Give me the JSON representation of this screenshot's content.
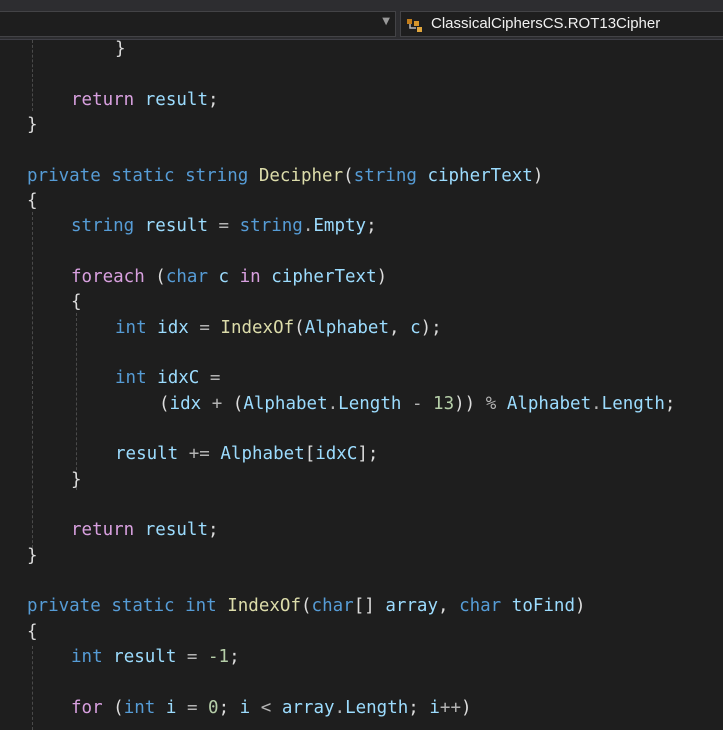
{
  "navigation_bar": {
    "left_dropdown_value": "",
    "right_dropdown_value": "ClassicalCiphersCS.ROT13Cipher",
    "member_icon": "class-member-icon",
    "dropdown_arrow_icon": "chevron-down-icon"
  },
  "colors": {
    "background": "#1e1e1e",
    "keyword": "#569cd6",
    "control_keyword": "#d8a0df",
    "method": "#dcdcaa",
    "identifier": "#9cdcfe",
    "number": "#b5cea8",
    "operator": "#b4b4b4",
    "plain": "#dcdcdc"
  },
  "editor": {
    "lines": [
      {
        "indent": 2,
        "tokens": [
          {
            "t": "}",
            "c": "pl"
          }
        ]
      },
      {
        "indent": 0,
        "tokens": []
      },
      {
        "indent": 1,
        "tokens": [
          {
            "t": "return",
            "c": "kw2"
          },
          {
            "t": " ",
            "c": "pl"
          },
          {
            "t": "result",
            "c": "var"
          },
          {
            "t": ";",
            "c": "pl"
          }
        ]
      },
      {
        "indent": 0,
        "tokens": [
          {
            "t": "}",
            "c": "pl"
          }
        ]
      },
      {
        "indent": 0,
        "tokens": []
      },
      {
        "indent": 0,
        "tokens": [
          {
            "t": "private",
            "c": "kw"
          },
          {
            "t": " ",
            "c": "pl"
          },
          {
            "t": "static",
            "c": "kw"
          },
          {
            "t": " ",
            "c": "pl"
          },
          {
            "t": "string",
            "c": "kw"
          },
          {
            "t": " ",
            "c": "pl"
          },
          {
            "t": "Decipher",
            "c": "fn"
          },
          {
            "t": "(",
            "c": "pl"
          },
          {
            "t": "string",
            "c": "kw"
          },
          {
            "t": " ",
            "c": "pl"
          },
          {
            "t": "cipherText",
            "c": "var"
          },
          {
            "t": ")",
            "c": "pl"
          }
        ]
      },
      {
        "indent": 0,
        "tokens": [
          {
            "t": "{",
            "c": "pl"
          }
        ]
      },
      {
        "indent": 1,
        "tokens": [
          {
            "t": "string",
            "c": "kw"
          },
          {
            "t": " ",
            "c": "pl"
          },
          {
            "t": "result",
            "c": "var"
          },
          {
            "t": " ",
            "c": "pl"
          },
          {
            "t": "=",
            "c": "op"
          },
          {
            "t": " ",
            "c": "pl"
          },
          {
            "t": "string",
            "c": "kw"
          },
          {
            "t": ".",
            "c": "op"
          },
          {
            "t": "Empty",
            "c": "var"
          },
          {
            "t": ";",
            "c": "pl"
          }
        ]
      },
      {
        "indent": 0,
        "tokens": []
      },
      {
        "indent": 1,
        "tokens": [
          {
            "t": "foreach",
            "c": "kw2"
          },
          {
            "t": " (",
            "c": "pl"
          },
          {
            "t": "char",
            "c": "kw"
          },
          {
            "t": " ",
            "c": "pl"
          },
          {
            "t": "c",
            "c": "var"
          },
          {
            "t": " ",
            "c": "pl"
          },
          {
            "t": "in",
            "c": "kw2"
          },
          {
            "t": " ",
            "c": "pl"
          },
          {
            "t": "cipherText",
            "c": "var"
          },
          {
            "t": ")",
            "c": "pl"
          }
        ]
      },
      {
        "indent": 1,
        "tokens": [
          {
            "t": "{",
            "c": "pl"
          }
        ]
      },
      {
        "indent": 2,
        "tokens": [
          {
            "t": "int",
            "c": "kw"
          },
          {
            "t": " ",
            "c": "pl"
          },
          {
            "t": "idx",
            "c": "var"
          },
          {
            "t": " ",
            "c": "pl"
          },
          {
            "t": "=",
            "c": "op"
          },
          {
            "t": " ",
            "c": "pl"
          },
          {
            "t": "IndexOf",
            "c": "fn"
          },
          {
            "t": "(",
            "c": "pl"
          },
          {
            "t": "Alphabet",
            "c": "var"
          },
          {
            "t": ", ",
            "c": "pl"
          },
          {
            "t": "c",
            "c": "var"
          },
          {
            "t": ");",
            "c": "pl"
          }
        ]
      },
      {
        "indent": 0,
        "tokens": []
      },
      {
        "indent": 2,
        "tokens": [
          {
            "t": "int",
            "c": "kw"
          },
          {
            "t": " ",
            "c": "pl"
          },
          {
            "t": "idxC",
            "c": "var"
          },
          {
            "t": " ",
            "c": "pl"
          },
          {
            "t": "=",
            "c": "op"
          }
        ]
      },
      {
        "indent": 3,
        "tokens": [
          {
            "t": "(",
            "c": "pl"
          },
          {
            "t": "idx",
            "c": "var"
          },
          {
            "t": " ",
            "c": "pl"
          },
          {
            "t": "+",
            "c": "op"
          },
          {
            "t": " (",
            "c": "pl"
          },
          {
            "t": "Alphabet",
            "c": "var"
          },
          {
            "t": ".",
            "c": "op"
          },
          {
            "t": "Length",
            "c": "var"
          },
          {
            "t": " ",
            "c": "pl"
          },
          {
            "t": "-",
            "c": "op"
          },
          {
            "t": " ",
            "c": "pl"
          },
          {
            "t": "13",
            "c": "num"
          },
          {
            "t": ")) ",
            "c": "pl"
          },
          {
            "t": "%",
            "c": "op"
          },
          {
            "t": " ",
            "c": "pl"
          },
          {
            "t": "Alphabet",
            "c": "var"
          },
          {
            "t": ".",
            "c": "op"
          },
          {
            "t": "Length",
            "c": "var"
          },
          {
            "t": ";",
            "c": "pl"
          }
        ]
      },
      {
        "indent": 0,
        "tokens": []
      },
      {
        "indent": 2,
        "tokens": [
          {
            "t": "result",
            "c": "var"
          },
          {
            "t": " ",
            "c": "pl"
          },
          {
            "t": "+=",
            "c": "op"
          },
          {
            "t": " ",
            "c": "pl"
          },
          {
            "t": "Alphabet",
            "c": "var"
          },
          {
            "t": "[",
            "c": "pl"
          },
          {
            "t": "idxC",
            "c": "var"
          },
          {
            "t": "];",
            "c": "pl"
          }
        ]
      },
      {
        "indent": 1,
        "tokens": [
          {
            "t": "}",
            "c": "pl"
          }
        ]
      },
      {
        "indent": 0,
        "tokens": []
      },
      {
        "indent": 1,
        "tokens": [
          {
            "t": "return",
            "c": "kw2"
          },
          {
            "t": " ",
            "c": "pl"
          },
          {
            "t": "result",
            "c": "var"
          },
          {
            "t": ";",
            "c": "pl"
          }
        ]
      },
      {
        "indent": 0,
        "tokens": [
          {
            "t": "}",
            "c": "pl"
          }
        ]
      },
      {
        "indent": 0,
        "tokens": []
      },
      {
        "indent": 0,
        "tokens": [
          {
            "t": "private",
            "c": "kw"
          },
          {
            "t": " ",
            "c": "pl"
          },
          {
            "t": "static",
            "c": "kw"
          },
          {
            "t": " ",
            "c": "pl"
          },
          {
            "t": "int",
            "c": "kw"
          },
          {
            "t": " ",
            "c": "pl"
          },
          {
            "t": "IndexOf",
            "c": "fn"
          },
          {
            "t": "(",
            "c": "pl"
          },
          {
            "t": "char",
            "c": "kw"
          },
          {
            "t": "[] ",
            "c": "pl"
          },
          {
            "t": "array",
            "c": "var"
          },
          {
            "t": ", ",
            "c": "pl"
          },
          {
            "t": "char",
            "c": "kw"
          },
          {
            "t": " ",
            "c": "pl"
          },
          {
            "t": "toFind",
            "c": "var"
          },
          {
            "t": ")",
            "c": "pl"
          }
        ]
      },
      {
        "indent": 0,
        "tokens": [
          {
            "t": "{",
            "c": "pl"
          }
        ]
      },
      {
        "indent": 1,
        "tokens": [
          {
            "t": "int",
            "c": "kw"
          },
          {
            "t": " ",
            "c": "pl"
          },
          {
            "t": "result",
            "c": "var"
          },
          {
            "t": " ",
            "c": "pl"
          },
          {
            "t": "=",
            "c": "op"
          },
          {
            "t": " ",
            "c": "pl"
          },
          {
            "t": "-1",
            "c": "num"
          },
          {
            "t": ";",
            "c": "pl"
          }
        ]
      },
      {
        "indent": 0,
        "tokens": []
      },
      {
        "indent": 1,
        "tokens": [
          {
            "t": "for",
            "c": "kw2"
          },
          {
            "t": " (",
            "c": "pl"
          },
          {
            "t": "int",
            "c": "kw"
          },
          {
            "t": " ",
            "c": "pl"
          },
          {
            "t": "i",
            "c": "var"
          },
          {
            "t": " ",
            "c": "pl"
          },
          {
            "t": "=",
            "c": "op"
          },
          {
            "t": " ",
            "c": "pl"
          },
          {
            "t": "0",
            "c": "num"
          },
          {
            "t": "; ",
            "c": "pl"
          },
          {
            "t": "i",
            "c": "var"
          },
          {
            "t": " ",
            "c": "pl"
          },
          {
            "t": "<",
            "c": "op"
          },
          {
            "t": " ",
            "c": "pl"
          },
          {
            "t": "array",
            "c": "var"
          },
          {
            "t": ".",
            "c": "op"
          },
          {
            "t": "Length",
            "c": "var"
          },
          {
            "t": "; ",
            "c": "pl"
          },
          {
            "t": "i",
            "c": "var"
          },
          {
            "t": "++",
            "c": "op"
          },
          {
            "t": ")",
            "c": "pl"
          }
        ]
      }
    ]
  }
}
